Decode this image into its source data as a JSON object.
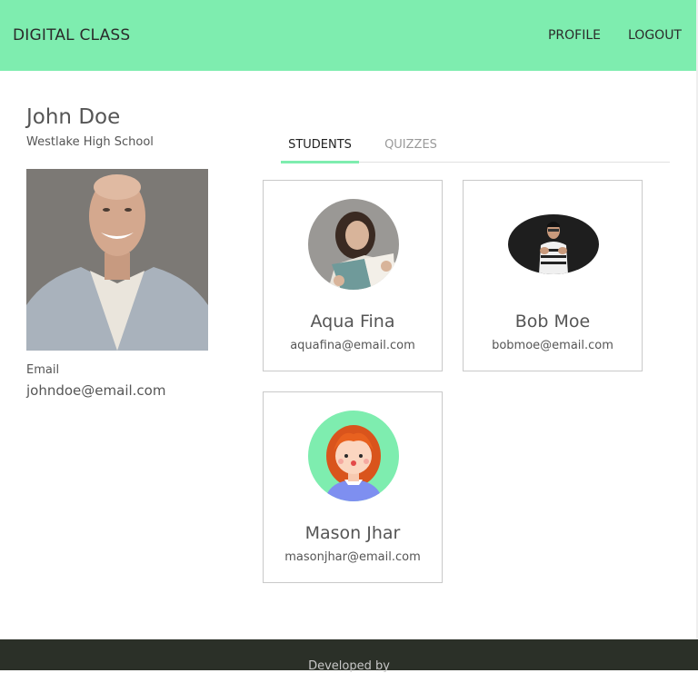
{
  "navbar": {
    "brand": "DIGITAL CLASS",
    "links": [
      "PROFILE",
      "LOGOUT"
    ],
    "color": "#7eedaf"
  },
  "profile": {
    "name": "John Doe",
    "school": "Westlake High School",
    "email_label": "Email",
    "email": "johndoe@email.com"
  },
  "tabs": [
    {
      "label": "STUDENTS",
      "active": true
    },
    {
      "label": "QUIZZES",
      "active": false
    }
  ],
  "students": [
    {
      "name": "Aqua Fina",
      "email": "aquafina@email.com",
      "avatar": "reading-girl-photo"
    },
    {
      "name": "Bob Moe",
      "email": "bobmoe@email.com",
      "avatar": "boy-dark-photo"
    },
    {
      "name": "Mason Jhar",
      "email": "masonjhar@email.com",
      "avatar": "cartoon-redhead-avatar"
    }
  ],
  "footer": {
    "text": "Developed by"
  }
}
